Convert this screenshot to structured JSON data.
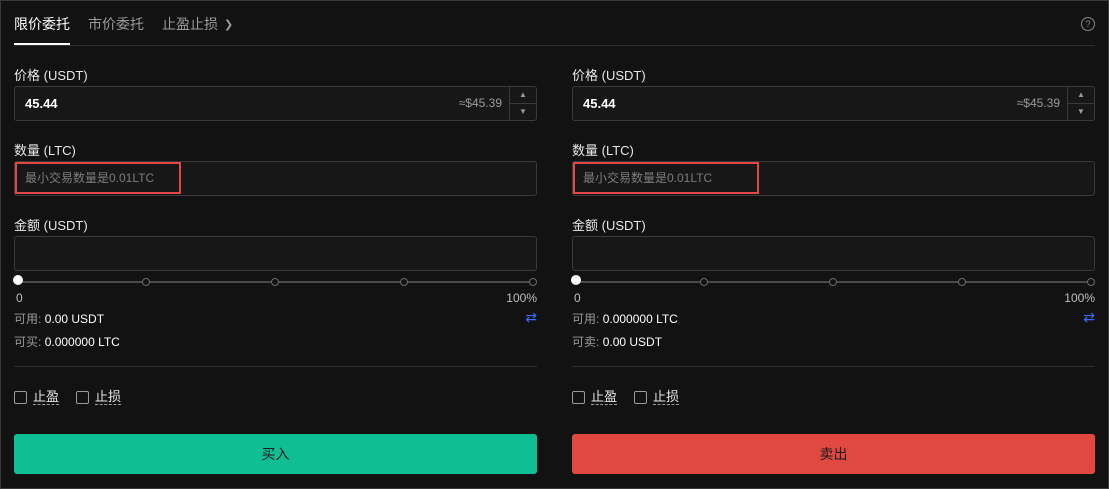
{
  "tabs": [
    {
      "label": "限价委托"
    },
    {
      "label": "市价委托"
    },
    {
      "label": "止盈止损"
    }
  ],
  "help_icon": "question-circle-icon",
  "buy_panel": {
    "price_label": "价格 (USDT)",
    "price_value": "45.44",
    "price_approx": "≈$45.39",
    "qty_label": "数量 (LTC)",
    "qty_placeholder": "最小交易数量是0.01LTC",
    "amount_label": "金额 (USDT)",
    "slider_min": "0",
    "slider_max": "100%",
    "slider_level": 0,
    "avail_label": "可用:",
    "avail_value": "0.00 USDT",
    "can_label": "可买:",
    "can_value": "0.000000 LTC",
    "tp_label": "止盈",
    "sl_label": "止损",
    "button_label": "买入",
    "button_color": "#0fbf93"
  },
  "sell_panel": {
    "price_label": "价格 (USDT)",
    "price_value": "45.44",
    "price_approx": "≈$45.39",
    "qty_label": "数量 (LTC)",
    "qty_placeholder": "最小交易数量是0.01LTC",
    "amount_label": "金额 (USDT)",
    "slider_min": "0",
    "slider_max": "100%",
    "slider_level": 0,
    "avail_label": "可用:",
    "avail_value": "0.000000 LTC",
    "can_label": "可卖:",
    "can_value": "0.00 USDT",
    "tp_label": "止盈",
    "sl_label": "止损",
    "button_label": "卖出",
    "button_color": "#e04840"
  },
  "highlight_color": "#e04848"
}
